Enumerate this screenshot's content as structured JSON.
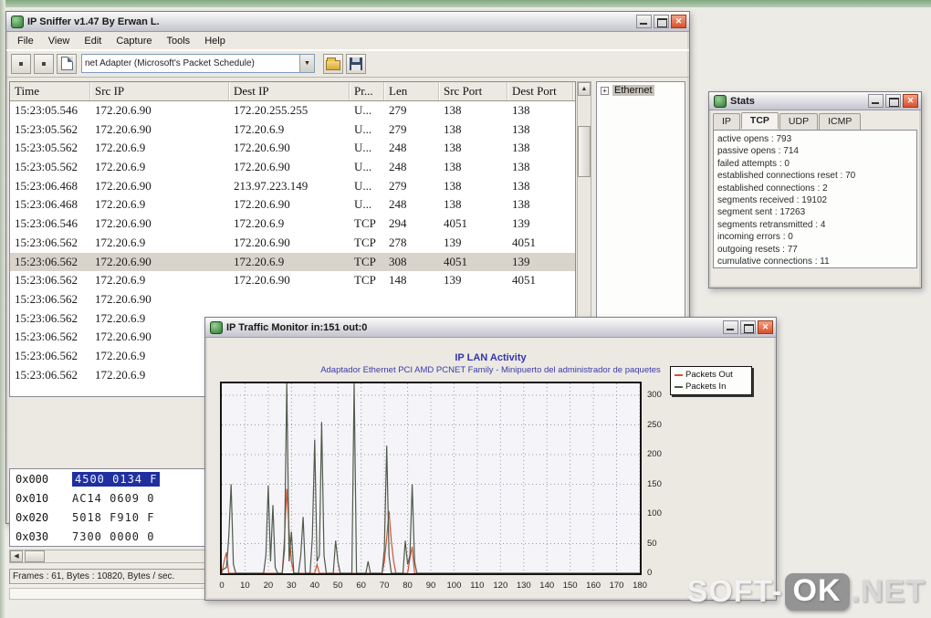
{
  "main_window": {
    "title": "IP Sniffer v1.47 By Erwan L.",
    "menu": [
      "File",
      "View",
      "Edit",
      "Capture",
      "Tools",
      "Help"
    ],
    "toolbar": {
      "adapter_dropdown_value": "net Adapter (Microsoft's Packet Schedule)",
      "dropdown_arrow": "▼"
    },
    "table": {
      "columns": [
        "Time",
        "Src IP",
        "Dest IP",
        "Pr...",
        "Len",
        "Src Port",
        "Dest Port"
      ],
      "selected_row_index": 8,
      "rows": [
        [
          "15:23:05.546",
          "172.20.6.90",
          "172.20.255.255",
          "U...",
          "279",
          "138",
          "138"
        ],
        [
          "15:23:05.562",
          "172.20.6.90",
          "172.20.6.9",
          "U...",
          "279",
          "138",
          "138"
        ],
        [
          "15:23:05.562",
          "172.20.6.9",
          "172.20.6.90",
          "U...",
          "248",
          "138",
          "138"
        ],
        [
          "15:23:05.562",
          "172.20.6.9",
          "172.20.6.90",
          "U...",
          "248",
          "138",
          "138"
        ],
        [
          "15:23:06.468",
          "172.20.6.90",
          "213.97.223.149",
          "U...",
          "279",
          "138",
          "138"
        ],
        [
          "15:23:06.468",
          "172.20.6.9",
          "172.20.6.90",
          "U...",
          "248",
          "138",
          "138"
        ],
        [
          "15:23:06.546",
          "172.20.6.90",
          "172.20.6.9",
          "TCP",
          "294",
          "4051",
          "139"
        ],
        [
          "15:23:06.562",
          "172.20.6.9",
          "172.20.6.90",
          "TCP",
          "278",
          "139",
          "4051"
        ],
        [
          "15:23:06.562",
          "172.20.6.90",
          "172.20.6.9",
          "TCP",
          "308",
          "4051",
          "139"
        ],
        [
          "15:23:06.562",
          "172.20.6.9",
          "172.20.6.90",
          "TCP",
          "148",
          "139",
          "4051"
        ],
        [
          "15:23:06.562",
          "172.20.6.90",
          "",
          "",
          "",
          "",
          ""
        ],
        [
          "15:23:06.562",
          "172.20.6.9",
          "",
          "",
          "",
          "",
          ""
        ],
        [
          "15:23:06.562",
          "172.20.6.90",
          "",
          "",
          "",
          "",
          ""
        ],
        [
          "15:23:06.562",
          "172.20.6.9",
          "",
          "",
          "",
          "",
          ""
        ],
        [
          "15:23:06.562",
          "172.20.6.9",
          "",
          "",
          "",
          "",
          ""
        ]
      ]
    },
    "tree": {
      "expander": "+",
      "root_label": "Ethernet"
    },
    "hex_view": {
      "rows": [
        {
          "offset": "0x000",
          "bytes": "4500 0134 F",
          "selected": true
        },
        {
          "offset": "0x010",
          "bytes": "AC14 0609 0",
          "selected": false
        },
        {
          "offset": "0x020",
          "bytes": "5018 F910 F",
          "selected": false
        },
        {
          "offset": "0x030",
          "bytes": "7300 0000 0",
          "selected": false
        }
      ]
    },
    "status_bar": "Frames : 61, Bytes : 10820, Bytes / sec."
  },
  "stats_window": {
    "title": "Stats",
    "tabs": [
      "IP",
      "TCP",
      "UDP",
      "ICMP"
    ],
    "active_tab": "TCP",
    "lines": [
      "active opens : 793",
      "passive opens : 714",
      "failed attempts : 0",
      "established connections reset : 70",
      "established connections : 2",
      "segments received : 19102",
      "segment sent : 17263",
      "segments retransmitted : 4",
      "incoming errors : 0",
      "outgoing resets : 77",
      "cumulative connections : 11"
    ]
  },
  "monitor_window": {
    "title": "IP Traffic Monitor in:151 out:0"
  },
  "chart_data": {
    "type": "line",
    "title": "IP LAN Activity",
    "subtitle": "Adaptador Ethernet PCI AMD PCNET Family - Minipuerto del administrador de paquetes",
    "xlabel": "",
    "ylabel": "",
    "xlim": [
      0,
      180
    ],
    "ylim": [
      0,
      320
    ],
    "x_ticks": [
      0,
      10,
      20,
      30,
      40,
      50,
      60,
      70,
      80,
      90,
      100,
      110,
      120,
      130,
      140,
      150,
      160,
      170,
      180
    ],
    "y_ticks": [
      0,
      50,
      100,
      150,
      200,
      250,
      300
    ],
    "grid": true,
    "legend_position": "top-right",
    "series": [
      {
        "name": "Packets Out",
        "color": "#cc5533",
        "points": [
          [
            0,
            0
          ],
          [
            1,
            20
          ],
          [
            2,
            35
          ],
          [
            3,
            0
          ],
          [
            26,
            0
          ],
          [
            27,
            60
          ],
          [
            28,
            142
          ],
          [
            29,
            70
          ],
          [
            30,
            20
          ],
          [
            31,
            0
          ],
          [
            40,
            0
          ],
          [
            41,
            15
          ],
          [
            42,
            0
          ],
          [
            69,
            0
          ],
          [
            70,
            20
          ],
          [
            71,
            60
          ],
          [
            72,
            105
          ],
          [
            73,
            55
          ],
          [
            74,
            20
          ],
          [
            75,
            0
          ],
          [
            80,
            0
          ],
          [
            81,
            25
          ],
          [
            82,
            45
          ],
          [
            83,
            0
          ],
          [
            180,
            0
          ]
        ]
      },
      {
        "name": "Packets In",
        "color": "#4f5a4a",
        "points": [
          [
            0,
            5
          ],
          [
            2,
            10
          ],
          [
            3,
            60
          ],
          [
            4,
            150
          ],
          [
            5,
            15
          ],
          [
            6,
            0
          ],
          [
            18,
            0
          ],
          [
            19,
            30
          ],
          [
            20,
            148
          ],
          [
            21,
            20
          ],
          [
            22,
            115
          ],
          [
            23,
            10
          ],
          [
            24,
            0
          ],
          [
            26,
            0
          ],
          [
            27,
            40
          ],
          [
            28,
            330
          ],
          [
            29,
            20
          ],
          [
            30,
            70
          ],
          [
            31,
            0
          ],
          [
            33,
            0
          ],
          [
            34,
            30
          ],
          [
            35,
            95
          ],
          [
            36,
            0
          ],
          [
            38,
            0
          ],
          [
            39,
            60
          ],
          [
            40,
            225
          ],
          [
            41,
            20
          ],
          [
            42,
            30
          ],
          [
            43,
            255
          ],
          [
            44,
            30
          ],
          [
            45,
            0
          ],
          [
            48,
            0
          ],
          [
            49,
            55
          ],
          [
            50,
            20
          ],
          [
            51,
            0
          ],
          [
            56,
            0
          ],
          [
            57,
            330
          ],
          [
            58,
            0
          ],
          [
            62,
            0
          ],
          [
            63,
            20
          ],
          [
            64,
            0
          ],
          [
            69,
            0
          ],
          [
            70,
            40
          ],
          [
            71,
            215
          ],
          [
            72,
            30
          ],
          [
            73,
            0
          ],
          [
            78,
            0
          ],
          [
            79,
            55
          ],
          [
            80,
            15
          ],
          [
            81,
            30
          ],
          [
            82,
            150
          ],
          [
            83,
            20
          ],
          [
            84,
            0
          ],
          [
            180,
            0
          ]
        ]
      }
    ]
  },
  "icons": {
    "close_glyph": "✕",
    "dropdown_glyph": "▼",
    "scroll_up_glyph": "▲",
    "scroll_left_glyph": "◀"
  },
  "watermark": {
    "part1": "SOFT-",
    "part2": "OK",
    "part3": ".NET"
  }
}
